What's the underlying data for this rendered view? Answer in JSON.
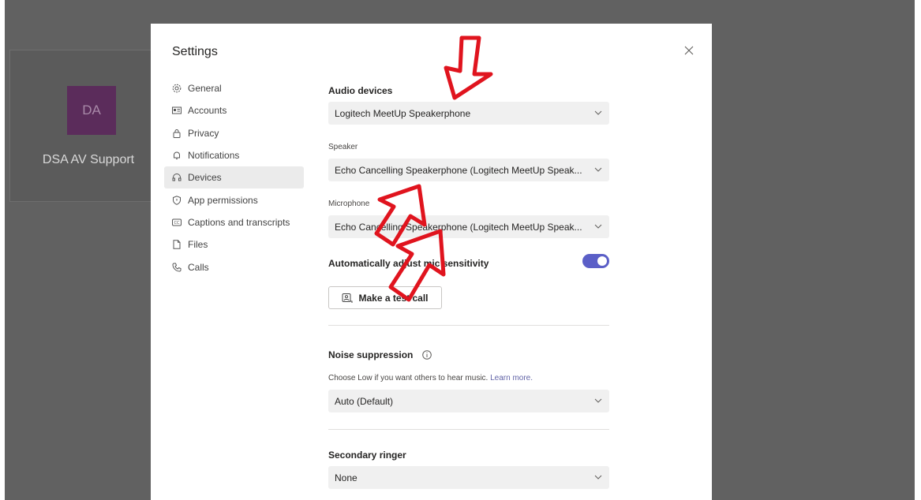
{
  "background": {
    "avatar_initials": "DA",
    "name": "DSA AV Support"
  },
  "dialog": {
    "title": "Settings",
    "close_icon": "close-icon"
  },
  "nav": {
    "items": [
      {
        "label": "General",
        "icon": "gear-icon"
      },
      {
        "label": "Accounts",
        "icon": "id-card-icon"
      },
      {
        "label": "Privacy",
        "icon": "lock-icon"
      },
      {
        "label": "Notifications",
        "icon": "bell-icon"
      },
      {
        "label": "Devices",
        "icon": "headset-icon",
        "active": true
      },
      {
        "label": "App permissions",
        "icon": "shield-icon"
      },
      {
        "label": "Captions and transcripts",
        "icon": "cc-icon"
      },
      {
        "label": "Files",
        "icon": "file-icon"
      },
      {
        "label": "Calls",
        "icon": "phone-icon"
      }
    ]
  },
  "devices": {
    "audio_devices_title": "Audio devices",
    "audio_device_value": "Logitech MeetUp Speakerphone",
    "speaker_label": "Speaker",
    "speaker_value": "Echo Cancelling Speakerphone (Logitech MeetUp Speak...",
    "microphone_label": "Microphone",
    "microphone_value": "Echo Cancelling Speakerphone (Logitech MeetUp Speak...",
    "auto_adjust_label": "Automatically adjust mic sensitivity",
    "auto_adjust_on": true,
    "test_call_label": "Make a test call",
    "noise_title": "Noise suppression",
    "noise_help": "Choose Low if you want others to hear music.",
    "noise_learn_more": "Learn more.",
    "noise_value": "Auto (Default)",
    "secondary_ringer_title": "Secondary ringer",
    "secondary_ringer_value": "None"
  },
  "colors": {
    "accent": "#5b5fc7",
    "annotation_arrow": "#e0141e",
    "avatar_bg": "#5b2c5b"
  }
}
